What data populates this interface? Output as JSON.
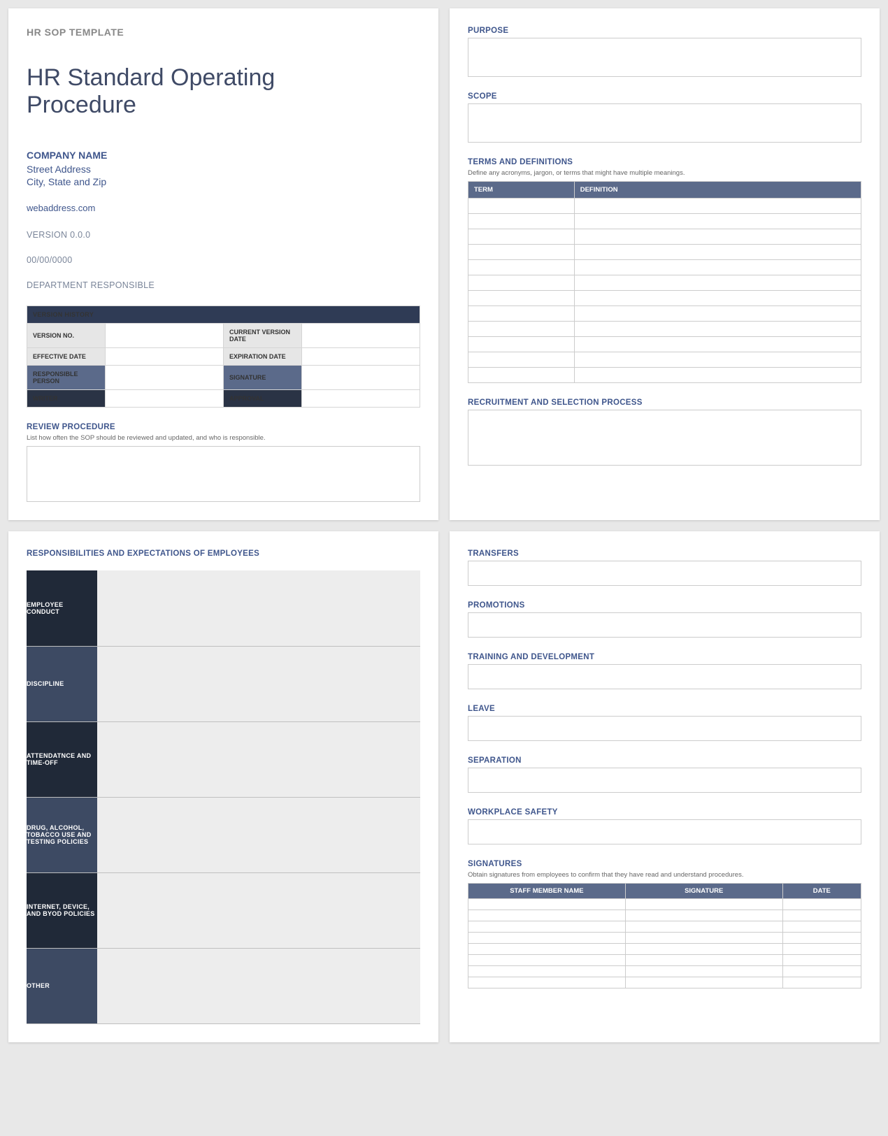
{
  "header": {
    "template_label": "HR SOP TEMPLATE",
    "title": "HR Standard Operating Procedure"
  },
  "company": {
    "name": "COMPANY NAME",
    "street": "Street Address",
    "city": "City, State and Zip",
    "web": "webaddress.com"
  },
  "meta": {
    "version": "VERSION 0.0.0",
    "date": "00/00/0000",
    "department": "DEPARTMENT RESPONSIBLE"
  },
  "version_history": {
    "title": "VERSION HISTORY",
    "rows": [
      {
        "label1": "VERSION NO.",
        "val1": "",
        "label2": "CURRENT VERSION DATE",
        "val2": "",
        "style": "light"
      },
      {
        "label1": "EFFECTIVE DATE",
        "val1": "",
        "label2": "EXPIRATION DATE",
        "val2": "",
        "style": "light"
      },
      {
        "label1": "RESPONSIBLE PERSON",
        "val1": "",
        "label2": "SIGNATURE",
        "val2": "",
        "style": "blue"
      },
      {
        "label1": "WRITER",
        "val1": "",
        "label2": "APPROVAL",
        "val2": "",
        "style": "dark"
      }
    ]
  },
  "review": {
    "title": "REVIEW PROCEDURE",
    "hint": "List how often the SOP should be reviewed and updated, and who is responsible."
  },
  "p2": {
    "purpose": "PURPOSE",
    "scope": "SCOPE",
    "terms_title": "TERMS AND DEFINITIONS",
    "terms_hint": "Define any acronyms, jargon, or terms that might have multiple meanings.",
    "terms_headers": {
      "term": "TERM",
      "definition": "DEFINITION"
    },
    "terms_rows": 12,
    "recruitment": "RECRUITMENT AND SELECTION PROCESS"
  },
  "p3": {
    "title": "RESPONSIBILITIES AND EXPECTATIONS OF EMPLOYEES",
    "rows": [
      {
        "label": "EMPLOYEE CONDUCT",
        "alt": "dark"
      },
      {
        "label": "DISCIPLINE",
        "alt": "light"
      },
      {
        "label": "ATTENDATNCE AND TIME-OFF",
        "alt": "dark"
      },
      {
        "label": "DRUG, ALCOHOL, TOBACCO USE AND TESTING POLICIES",
        "alt": "light"
      },
      {
        "label": "INTERNET, DEVICE, AND BYOD POLICIES",
        "alt": "dark"
      },
      {
        "label": "OTHER",
        "alt": "light"
      }
    ]
  },
  "p4": {
    "transfers": "TRANSFERS",
    "promotions": "PROMOTIONS",
    "training": "TRAINING AND DEVELOPMENT",
    "leave": "LEAVE",
    "separation": "SEPARATION",
    "safety": "WORKPLACE SAFETY",
    "signatures_title": "SIGNATURES",
    "signatures_hint": "Obtain signatures from employees to confirm that they have read and understand procedures.",
    "sig_headers": {
      "name": "STAFF MEMBER NAME",
      "sig": "SIGNATURE",
      "date": "DATE"
    },
    "sig_rows": 8
  }
}
